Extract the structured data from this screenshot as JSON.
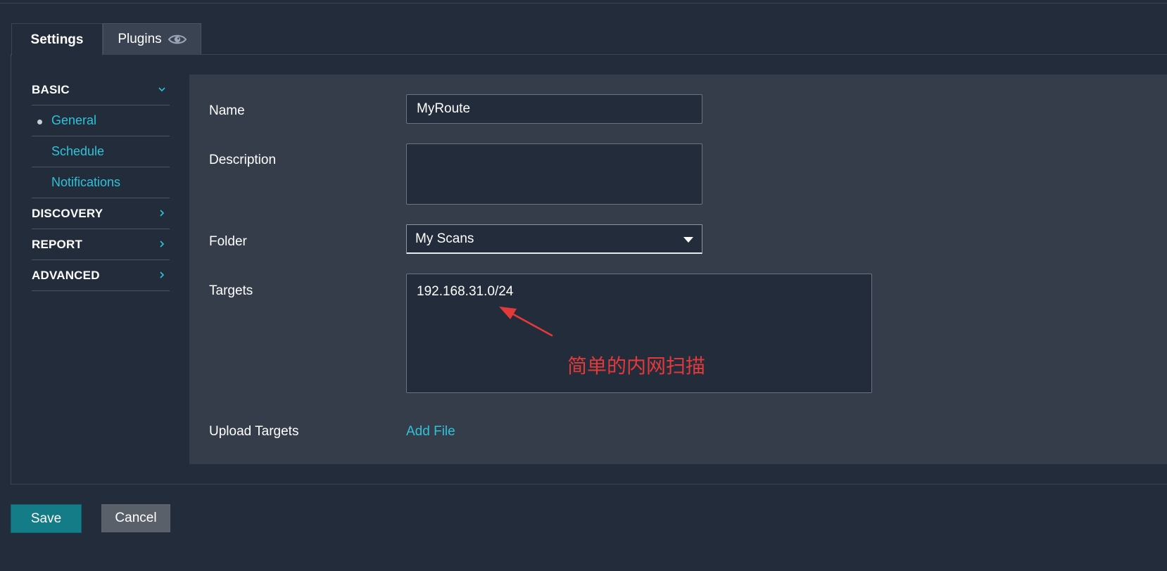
{
  "tabs": [
    {
      "label": "Settings",
      "active": true
    },
    {
      "label": "Plugins",
      "icon": "eye-icon"
    }
  ],
  "sidebar": {
    "sections": [
      {
        "label": "BASIC",
        "expanded": true,
        "icon": "chevron-down-icon",
        "items": [
          {
            "label": "General",
            "selected": true
          },
          {
            "label": "Schedule"
          },
          {
            "label": "Notifications"
          }
        ]
      },
      {
        "label": "DISCOVERY",
        "expanded": false,
        "icon": "chevron-right-icon"
      },
      {
        "label": "REPORT",
        "expanded": false,
        "icon": "chevron-right-icon"
      },
      {
        "label": "ADVANCED",
        "expanded": false,
        "icon": "chevron-right-icon"
      }
    ]
  },
  "form": {
    "name": {
      "label": "Name",
      "value": "MyRoute"
    },
    "description": {
      "label": "Description",
      "value": ""
    },
    "folder": {
      "label": "Folder",
      "value": "My Scans"
    },
    "targets": {
      "label": "Targets",
      "value": "192.168.31.0/24"
    },
    "upload": {
      "label": "Upload Targets",
      "link": "Add File"
    }
  },
  "annotation": {
    "text": "简单的内网扫描",
    "color": "#e3393a"
  },
  "buttons": {
    "save": "Save",
    "cancel": "Cancel"
  },
  "colors": {
    "accent": "#2ec3d9",
    "save_button": "#137c87",
    "background": "#232c3b",
    "content": "#353d4b"
  }
}
